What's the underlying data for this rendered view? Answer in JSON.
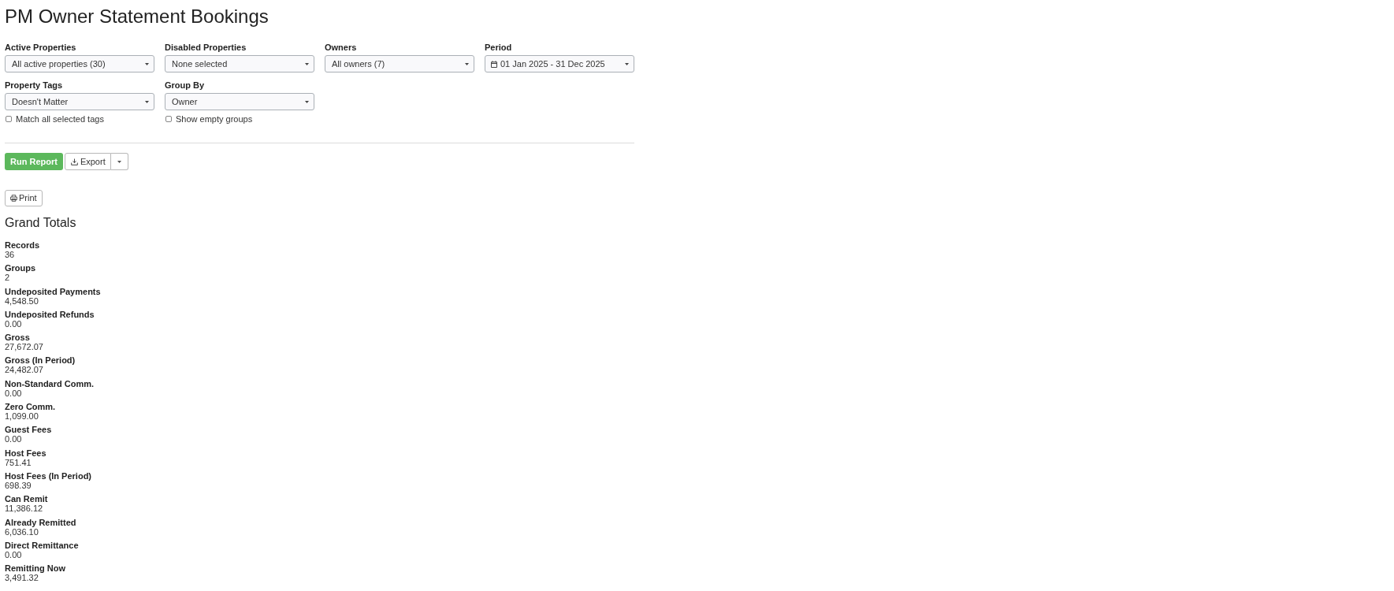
{
  "page": {
    "title": "PM Owner Statement Bookings"
  },
  "filters": [
    {
      "label": "Active Properties",
      "value": "All active properties (30)",
      "kind": "select"
    },
    {
      "label": "Disabled Properties",
      "value": "None selected",
      "kind": "select"
    },
    {
      "label": "Owners",
      "value": "All owners (7)",
      "kind": "select"
    },
    {
      "label": "Period",
      "value": "01 Jan 2025 - 31 Dec 2025",
      "kind": "date_range"
    },
    {
      "label": "Property Tags",
      "value": "Doesn't Matter",
      "kind": "select",
      "checkbox": {
        "label": "Match all selected tags",
        "checked": false
      }
    },
    {
      "label": "Group By",
      "value": "Owner",
      "kind": "select",
      "checkbox": {
        "label": "Show empty groups",
        "checked": false
      }
    }
  ],
  "actions": {
    "run_button": "Run Report",
    "export_button": "Export",
    "print_button": "Print"
  },
  "grand_totals": {
    "title": "Grand Totals",
    "items": [
      {
        "label": "Records",
        "value": "36"
      },
      {
        "label": "Groups",
        "value": "2"
      },
      {
        "label": "Undeposited Payments",
        "value": "4,548.50"
      },
      {
        "label": "Undeposited Refunds",
        "value": "0.00"
      },
      {
        "label": "Gross",
        "value": "27,672.07"
      },
      {
        "label": "Gross (In Period)",
        "value": "24,482.07"
      },
      {
        "label": "Non-Standard Comm.",
        "value": "0.00"
      },
      {
        "label": "Zero Comm.",
        "value": "1,099.00"
      },
      {
        "label": "Guest Fees",
        "value": "0.00"
      },
      {
        "label": "Host Fees",
        "value": "751.41"
      },
      {
        "label": "Host Fees (In Period)",
        "value": "698.39"
      },
      {
        "label": "Can Remit",
        "value": "11,386.12"
      },
      {
        "label": "Already Remitted",
        "value": "6,036.10"
      },
      {
        "label": "Direct Remittance",
        "value": "0.00"
      },
      {
        "label": "Remitting Now",
        "value": "3,491.32"
      }
    ]
  }
}
